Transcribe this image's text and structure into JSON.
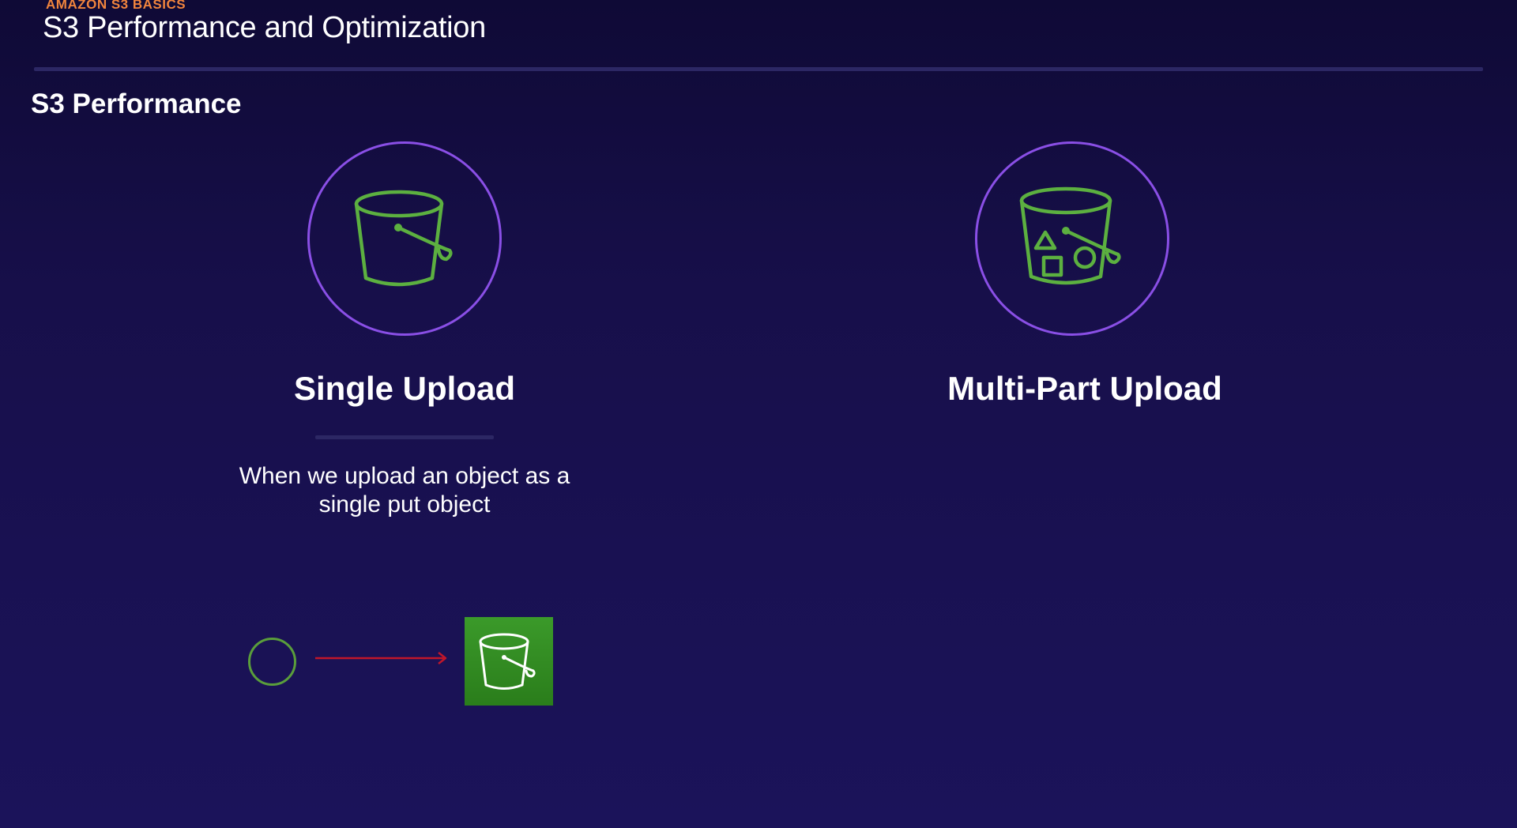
{
  "header": {
    "kicker": "AMAZON S3 BASICS",
    "title": "S3 Performance and Optimization"
  },
  "section": {
    "heading": "S3 Performance"
  },
  "options": [
    {
      "title": "Single Upload",
      "icon": "bucket-icon",
      "description_line1": "When we upload an object as a",
      "description_line2": "single put object"
    },
    {
      "title": "Multi-Part Upload",
      "icon": "bucket-with-objects-icon"
    }
  ],
  "demo": {
    "object_icon": "object-circle-icon",
    "arrow_icon": "arrow-right-icon",
    "bucket_icon": "s3-bucket-icon"
  },
  "colors": {
    "kicker": "#f0843d",
    "circle_border": "#8a4fe6",
    "icon_green": "#5cb040",
    "arrow_red": "#c0162a",
    "bucket_tile": "#3b9a2a"
  }
}
